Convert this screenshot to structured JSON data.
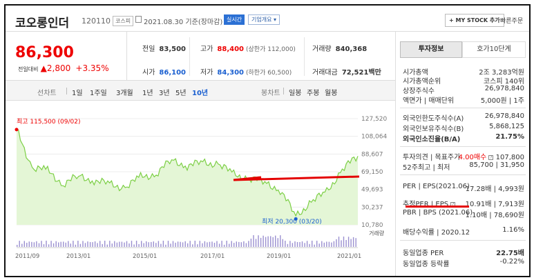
{
  "header": {
    "stock_name": "코오롱인더",
    "stock_code": "120110",
    "market_badge": "코스피",
    "date_text": "2021.08.30 기준(장마감)",
    "realtime_label": "실시간",
    "company_overview_label": "기업개요",
    "mystock_label": "+ MY STOCK 추가",
    "quick_order_label": "빠른주문"
  },
  "price": {
    "current": "86,300",
    "change_label": "전일대비",
    "change_amount": "▲2,800",
    "change_percent": "+3.35%"
  },
  "quote": {
    "prev_close_label": "전일",
    "prev_close": "83,500",
    "high_label": "고가",
    "high": "88,400",
    "upper_limit": "(상한가 112,000)",
    "volume_label": "거래량",
    "volume": "840,368",
    "open_label": "시가",
    "open": "86,100",
    "low_label": "저가",
    "low": "84,300",
    "lower_limit": "(하한가 60,500)",
    "amount_label": "거래대금",
    "amount": "72,521백만"
  },
  "periods": {
    "line_chart_label": "선차트",
    "items": [
      "1일",
      "1주일",
      "3개월",
      "1년",
      "3년",
      "5년",
      "10년"
    ],
    "selected": "10년",
    "candle_chart_label": "봉차트",
    "candle_items": [
      "일봉",
      "주봉",
      "월봉"
    ]
  },
  "chart_data": {
    "type": "area",
    "y_ticks": [
      "127,520",
      "108,064",
      "88,607",
      "69,150",
      "49,693",
      "30,237",
      "10,780"
    ],
    "ylim": [
      10780,
      127520
    ],
    "x_ticks": [
      "2011/09",
      "2013/01",
      "2015/01",
      "2017/01",
      "2019/01",
      "2021/01"
    ],
    "high_annotation": "최고 115,500 (09/02)",
    "low_annotation": "최저 20,300 (03/20)",
    "volume_label": "거래량",
    "x": [
      "2011/09",
      "2011/12",
      "2012/06",
      "2012/12",
      "2013/06",
      "2013/12",
      "2014/06",
      "2014/12",
      "2015/06",
      "2015/12",
      "2016/06",
      "2016/12",
      "2017/06",
      "2017/12",
      "2018/06",
      "2018/12",
      "2019/06",
      "2019/12",
      "2020/03",
      "2020/06",
      "2020/12",
      "2021/04",
      "2021/08"
    ],
    "values": [
      115500,
      74000,
      70000,
      56000,
      64000,
      60000,
      55000,
      52000,
      63000,
      67000,
      82000,
      76000,
      79000,
      78000,
      66000,
      62000,
      58000,
      49000,
      20300,
      36000,
      47000,
      72000,
      86300
    ],
    "line_color": "#7ccf45",
    "fill_color": "#e4f6d6"
  },
  "panel": {
    "tab_invest": "투자정보",
    "tab_ask": "호가10단계",
    "market_cap_label": "시가총액",
    "market_cap": "2조 3,283억원",
    "market_cap_rank_label": "시가총액순위",
    "market_cap_rank": "코스피 140위",
    "shares_label": "상장주식수",
    "shares": "26,978,840",
    "par_label": "액면가 | 매매단위",
    "par": "5,000원 | 1주",
    "foreign_limit_label": "외국인한도주식수(A)",
    "foreign_limit": "26,978,840",
    "foreign_hold_label": "외국인보유주식수(B)",
    "foreign_hold": "5,868,125",
    "foreign_ratio_label": "외국인소진율(B/A)",
    "foreign_ratio": "21.75%",
    "opinion_label": "투자의견 | 목표주가",
    "opinion": "4.00매수",
    "target": "107,800",
    "week52_label": "52주최고 | 최저",
    "week52": "85,700 | 31,950",
    "per_label": "PER | EPS(2021.06)",
    "per": "17.28배",
    "eps": "4,993원",
    "est_per_label": "추정PER | EPS",
    "est_per": "10.91배",
    "est_eps": "7,913원",
    "pbr_label": "PBR | BPS (2021.06)",
    "pbr": "1.10배",
    "bps": "78,690원",
    "dividend_label": "배당수익률 | 2020.12",
    "dividend": "1.16%",
    "industry_per_label": "동일업종 PER",
    "industry_per": "22.75배",
    "industry_change_label": "동일업종 등락률",
    "industry_change": "-0.22%"
  }
}
